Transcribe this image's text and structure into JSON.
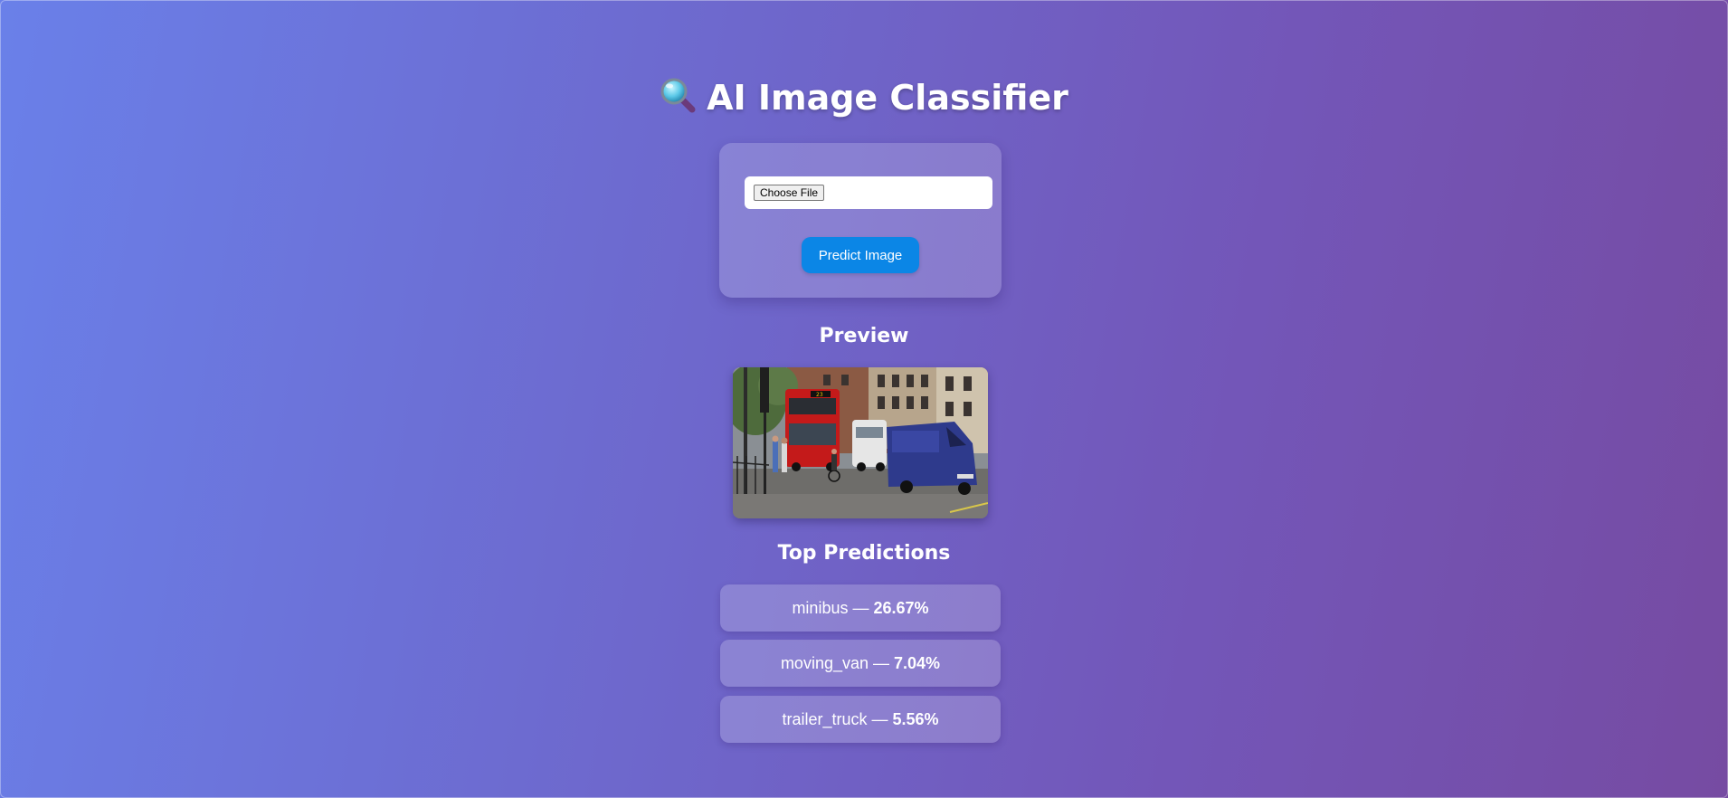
{
  "header": {
    "title": "AI Image Classifier",
    "icon": "magnifying-glass-icon"
  },
  "upload": {
    "choose_file_label": "Choose File",
    "predict_label": "Predict Image"
  },
  "preview": {
    "heading": "Preview"
  },
  "predictions": {
    "heading": "Top Predictions",
    "separator": " — ",
    "items": [
      {
        "label": "minibus",
        "percent": "26.67%"
      },
      {
        "label": "moving_van",
        "percent": "7.04%"
      },
      {
        "label": "trailer_truck",
        "percent": "5.56%"
      }
    ]
  },
  "colors": {
    "gradient_start": "#6a80e9",
    "gradient_end": "#764ba2",
    "predict_button": "#0b86e6"
  }
}
